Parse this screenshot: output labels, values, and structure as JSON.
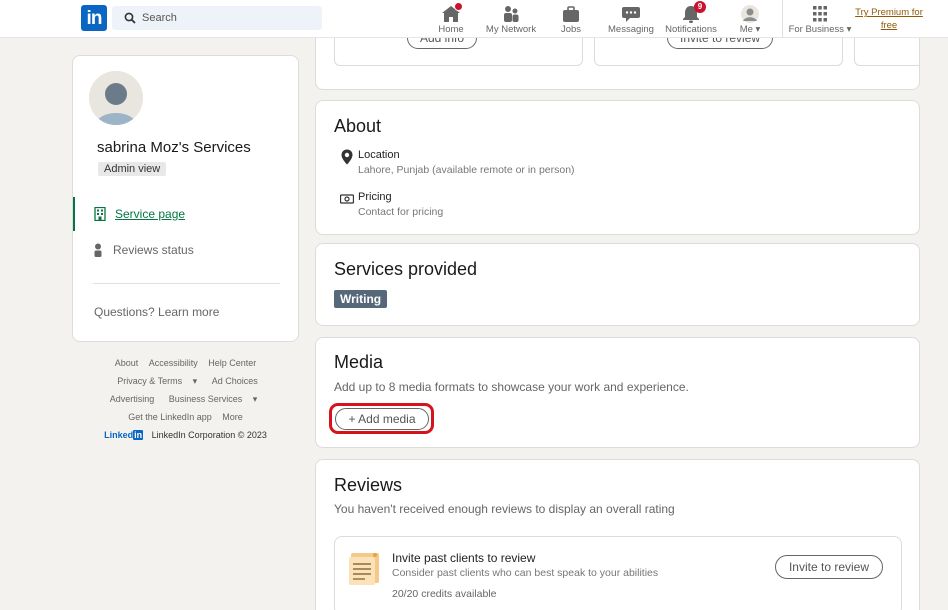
{
  "nav": {
    "search_placeholder": "Search",
    "items": [
      {
        "label": "Home",
        "icon": "home-icon"
      },
      {
        "label": "My Network",
        "icon": "people-icon"
      },
      {
        "label": "Jobs",
        "icon": "briefcase-icon"
      },
      {
        "label": "Messaging",
        "icon": "chat-icon"
      },
      {
        "label": "Notifications",
        "icon": "bell-icon",
        "badge": "9"
      },
      {
        "label": "Me",
        "icon": "avatar-icon"
      },
      {
        "label": "For Business",
        "icon": "grid-icon"
      }
    ],
    "premium_line1": "Try Premium for",
    "premium_line2": "free"
  },
  "sidebar": {
    "name": "sabrina Moz's Services",
    "tag": "Admin view",
    "menu": [
      {
        "label": "Service page",
        "icon": "building-icon",
        "active": true
      },
      {
        "label": "Reviews status",
        "icon": "person-icon",
        "active": false
      }
    ],
    "questions": "Questions? Learn more"
  },
  "footer": {
    "row1": [
      "About",
      "Accessibility",
      "Help Center"
    ],
    "row2": [
      "Privacy & Terms",
      "Ad Choices"
    ],
    "row3": [
      "Advertising",
      "Business Services"
    ],
    "row4": [
      "Get the LinkedIn app",
      "More"
    ],
    "logo_text": "Linked",
    "logo_in": "in",
    "copyright": "LinkedIn Corporation © 2023"
  },
  "top_strip": {
    "add_info": "Add info",
    "invite_to_review": "Invite to review"
  },
  "about": {
    "title": "About",
    "location_label": "Location",
    "location_value": "Lahore, Punjab (available remote or in person)",
    "pricing_label": "Pricing",
    "pricing_value": "Contact for pricing"
  },
  "services": {
    "title": "Services provided",
    "tags": [
      "Writing"
    ]
  },
  "media": {
    "title": "Media",
    "description": "Add up to 8 media formats to showcase your work and experience.",
    "add_button": "+ Add media"
  },
  "reviews": {
    "title": "Reviews",
    "description": "You haven't received enough reviews to display an overall rating",
    "invite_title": "Invite past clients to review",
    "invite_sub": "Consider past clients who can best speak to your abilities",
    "credits": "20/20 credits available",
    "invite_button": "Invite to review"
  },
  "colors": {
    "brand": "#0a66c2",
    "active_green": "#057642",
    "badge_red": "#cb112d",
    "highlight_red": "#d6131c",
    "skill_tag": "#56687a",
    "premium": "#915907"
  }
}
